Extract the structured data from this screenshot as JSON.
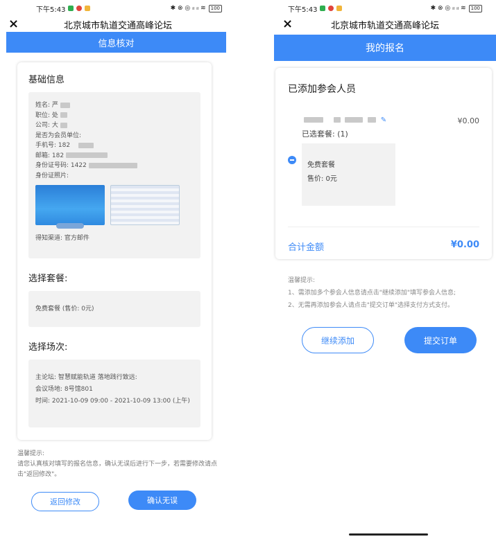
{
  "left": {
    "status": {
      "time": "下午5:43",
      "icons": "✱ ⊗ ◎ ᵢₗ ᵢₗ ≋",
      "battery": "100"
    },
    "nav_title": "北京城市轨道交通高峰论坛",
    "close_label": "×",
    "header": "信息核对",
    "basic": {
      "title": "基础信息",
      "name": "姓名: 严",
      "position": "职位: 处",
      "company": "公司: 大",
      "member": "是否为会员单位:",
      "phone": "手机号: 182",
      "email": "邮箱: 182",
      "id_number": "身份证号码: 1422",
      "id_photo": "身份证照片:",
      "source": "得知渠道: 官方邮件"
    },
    "package": {
      "title": "选择套餐:",
      "value": "免费套餐 (售价: 0元)"
    },
    "session": {
      "title": "选择场次:",
      "forum": "主论坛: 智慧赋能轨道 落地践行致远:",
      "venue": "会议场地: 8号馆801",
      "time": "时间: 2021-10-09 09:00 - 2021-10-09 13:00 (上午)"
    },
    "tips": {
      "title": "温馨提示:",
      "body": "请您认真核对填写的报名信息，确认无误后进行下一步，若需要修改请点击\"返回修改\"。"
    },
    "btn_back": "返回修改",
    "btn_confirm": "确认无误"
  },
  "right": {
    "status": {
      "time": "下午5:43",
      "icons": "✱ ⊗ ◎ ᵢₗ ᵢₗ ≋",
      "battery": "100"
    },
    "nav_title": "北京城市轨道交通高峰论坛",
    "close_label": "×",
    "header": "我的报名",
    "card": {
      "title": "已添加参会人员",
      "attendee_price": "¥0.00",
      "selected": "已选套餐: (1)",
      "pkg_name": "免费套餐",
      "pkg_price": "售价: 0元",
      "total_label": "合计金额",
      "total_value": "¥0.00"
    },
    "tips": {
      "title": "温馨提示:",
      "line1": "1、需添加多个参会人信息请点击\"继续添加\"填写参会人信息;",
      "line2": "2、无需再添加参会人请点击\"提交订单\"选择支付方式支付。"
    },
    "btn_continue": "继续添加",
    "btn_submit": "提交订单"
  },
  "colors": {
    "accent": "#3d8af7",
    "card_bg": "#f2f2f2"
  }
}
